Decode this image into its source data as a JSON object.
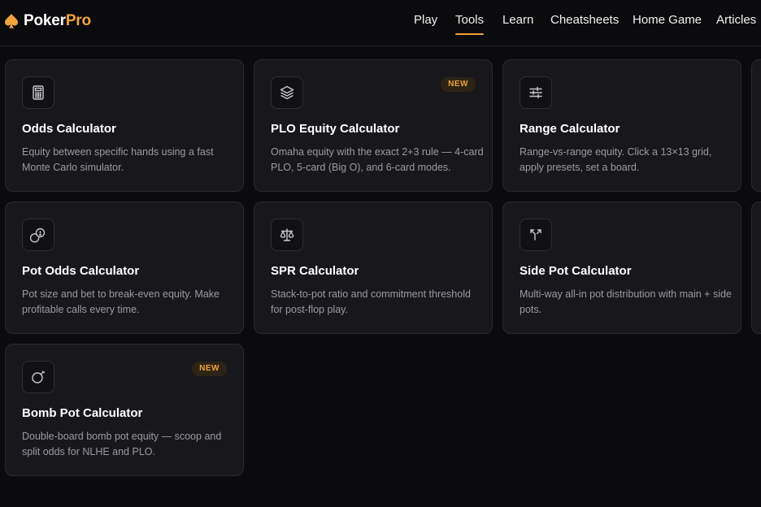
{
  "brand": {
    "name_part1": "Poker",
    "name_part2": "Pro",
    "accent": "#f0a43b"
  },
  "nav": {
    "items": [
      {
        "label": "Play",
        "active": false
      },
      {
        "label": "Tools",
        "active": true
      },
      {
        "label": "Learn",
        "active": false
      },
      {
        "label": "Cheatsheets",
        "active": false
      },
      {
        "label": "Home Game",
        "active": false
      },
      {
        "label": "Articles",
        "active": false
      }
    ]
  },
  "tools": [
    {
      "icon": "calculator-icon",
      "title": "Odds Calculator",
      "description": "Equity between specific hands using a fast Monte Carlo simulator.",
      "badge": ""
    },
    {
      "icon": "layers-icon",
      "title": "PLO Equity Calculator",
      "description": "Omaha equity with the exact 2+3 rule — 4-card PLO, 5-card (Big O), and 6-card modes.",
      "badge": "NEW"
    },
    {
      "icon": "sliders-icon",
      "title": "Range Calculator",
      "description": "Range-vs-range equity. Click a 13×13 grid, apply presets, set a board.",
      "badge": ""
    },
    {
      "icon": "coins-icon",
      "title": "Pot Odds Calculator",
      "description": "Pot size and bet to break-even equity. Make profitable calls every time.",
      "badge": ""
    },
    {
      "icon": "scale-icon",
      "title": "SPR Calculator",
      "description": "Stack-to-pot ratio and commitment threshold for post-flop play.",
      "badge": ""
    },
    {
      "icon": "split-icon",
      "title": "Side Pot Calculator",
      "description": "Multi-way all-in pot distribution with main + side pots.",
      "badge": ""
    },
    {
      "icon": "bomb-icon",
      "title": "Bomb Pot Calculator",
      "description": "Double-board bomb pot equity — scoop and split odds for NLHE and PLO.",
      "badge": "NEW"
    }
  ]
}
